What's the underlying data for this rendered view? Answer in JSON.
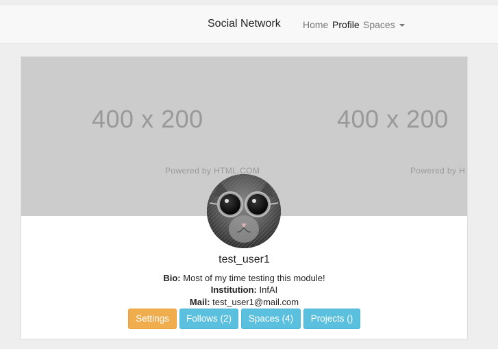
{
  "navbar": {
    "brand": "Social Network",
    "links": [
      "Home",
      "Profile",
      "Spaces"
    ]
  },
  "cover": {
    "placeholder_size": "400 x 200",
    "placeholder_powered": "Powered by HTML.COM",
    "placeholder_powered_cut": "Powered by H"
  },
  "profile": {
    "username": "test_user1",
    "bio_label": "Bio:",
    "bio": "Most of my time testing this module!",
    "institution_label": "Institution:",
    "institution": "InfAI",
    "mail_label": "Mail:",
    "mail": "test_user1@mail.com"
  },
  "buttons": {
    "settings": "Settings",
    "follows": "Follows (2)",
    "spaces": "Spaces (4)",
    "projects": "Projects ()"
  },
  "colors": {
    "warning": "#f0ad4e",
    "info": "#5bc0de"
  },
  "icons": [
    "caret-down-icon"
  ]
}
